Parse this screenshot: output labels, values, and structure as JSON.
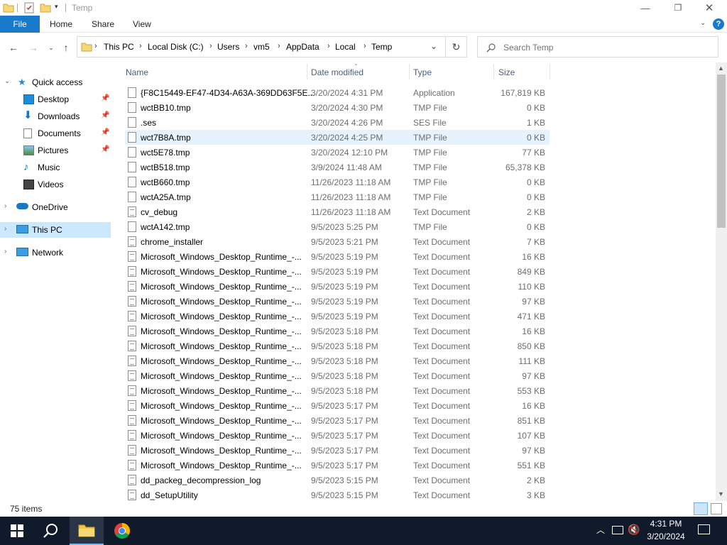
{
  "window": {
    "title": "Temp",
    "min_icon": "minimize-icon",
    "max_icon": "maximize-icon",
    "close_icon": "close-icon"
  },
  "ribbon": {
    "tabs": [
      {
        "label": "File"
      },
      {
        "label": "Home"
      },
      {
        "label": "Share"
      },
      {
        "label": "View"
      }
    ]
  },
  "address": {
    "crumbs": [
      "This PC",
      "Local Disk (C:)",
      "Users",
      "vm5",
      "AppData",
      "Local",
      "Temp"
    ]
  },
  "search": {
    "placeholder": "Search Temp"
  },
  "nav": {
    "quick_access": "Quick access",
    "items": [
      {
        "label": "Desktop",
        "icon": "desktop-icon",
        "pinned": true
      },
      {
        "label": "Downloads",
        "icon": "downloads-icon",
        "pinned": true
      },
      {
        "label": "Documents",
        "icon": "documents-icon",
        "pinned": true
      },
      {
        "label": "Pictures",
        "icon": "pictures-icon",
        "pinned": true
      },
      {
        "label": "Music",
        "icon": "music-icon",
        "pinned": false
      },
      {
        "label": "Videos",
        "icon": "videos-icon",
        "pinned": false
      }
    ],
    "onedrive": "OneDrive",
    "this_pc": "This PC",
    "network": "Network"
  },
  "columns": {
    "name": "Name",
    "date": "Date modified",
    "type": "Type",
    "size": "Size"
  },
  "files": [
    {
      "name": "{F8C15449-EF47-4D34-A63A-369DD63F5E...",
      "date": "3/20/2024 4:31 PM",
      "type": "Application",
      "size": "167,819 KB"
    },
    {
      "name": "wctBB10.tmp",
      "date": "3/20/2024 4:30 PM",
      "type": "TMP File",
      "size": "0 KB"
    },
    {
      "name": ".ses",
      "date": "3/20/2024 4:26 PM",
      "type": "SES File",
      "size": "1 KB"
    },
    {
      "name": "wct7B8A.tmp",
      "date": "3/20/2024 4:25 PM",
      "type": "TMP File",
      "size": "0 KB"
    },
    {
      "name": "wct5E78.tmp",
      "date": "3/20/2024 12:10 PM",
      "type": "TMP File",
      "size": "77 KB"
    },
    {
      "name": "wctB518.tmp",
      "date": "3/9/2024 11:48 AM",
      "type": "TMP File",
      "size": "65,378 KB"
    },
    {
      "name": "wctB660.tmp",
      "date": "11/26/2023 11:18 AM",
      "type": "TMP File",
      "size": "0 KB"
    },
    {
      "name": "wctA25A.tmp",
      "date": "11/26/2023 11:18 AM",
      "type": "TMP File",
      "size": "0 KB"
    },
    {
      "name": "cv_debug",
      "date": "11/26/2023 11:18 AM",
      "type": "Text Document",
      "size": "2 KB"
    },
    {
      "name": "wctA142.tmp",
      "date": "9/5/2023 5:25 PM",
      "type": "TMP File",
      "size": "0 KB"
    },
    {
      "name": "chrome_installer",
      "date": "9/5/2023 5:21 PM",
      "type": "Text Document",
      "size": "7 KB"
    },
    {
      "name": "Microsoft_Windows_Desktop_Runtime_-...",
      "date": "9/5/2023 5:19 PM",
      "type": "Text Document",
      "size": "16 KB"
    },
    {
      "name": "Microsoft_Windows_Desktop_Runtime_-...",
      "date": "9/5/2023 5:19 PM",
      "type": "Text Document",
      "size": "849 KB"
    },
    {
      "name": "Microsoft_Windows_Desktop_Runtime_-...",
      "date": "9/5/2023 5:19 PM",
      "type": "Text Document",
      "size": "110 KB"
    },
    {
      "name": "Microsoft_Windows_Desktop_Runtime_-...",
      "date": "9/5/2023 5:19 PM",
      "type": "Text Document",
      "size": "97 KB"
    },
    {
      "name": "Microsoft_Windows_Desktop_Runtime_-...",
      "date": "9/5/2023 5:19 PM",
      "type": "Text Document",
      "size": "471 KB"
    },
    {
      "name": "Microsoft_Windows_Desktop_Runtime_-...",
      "date": "9/5/2023 5:18 PM",
      "type": "Text Document",
      "size": "16 KB"
    },
    {
      "name": "Microsoft_Windows_Desktop_Runtime_-...",
      "date": "9/5/2023 5:18 PM",
      "type": "Text Document",
      "size": "850 KB"
    },
    {
      "name": "Microsoft_Windows_Desktop_Runtime_-...",
      "date": "9/5/2023 5:18 PM",
      "type": "Text Document",
      "size": "111 KB"
    },
    {
      "name": "Microsoft_Windows_Desktop_Runtime_-...",
      "date": "9/5/2023 5:18 PM",
      "type": "Text Document",
      "size": "97 KB"
    },
    {
      "name": "Microsoft_Windows_Desktop_Runtime_-...",
      "date": "9/5/2023 5:18 PM",
      "type": "Text Document",
      "size": "553 KB"
    },
    {
      "name": "Microsoft_Windows_Desktop_Runtime_-...",
      "date": "9/5/2023 5:17 PM",
      "type": "Text Document",
      "size": "16 KB"
    },
    {
      "name": "Microsoft_Windows_Desktop_Runtime_-...",
      "date": "9/5/2023 5:17 PM",
      "type": "Text Document",
      "size": "851 KB"
    },
    {
      "name": "Microsoft_Windows_Desktop_Runtime_-...",
      "date": "9/5/2023 5:17 PM",
      "type": "Text Document",
      "size": "107 KB"
    },
    {
      "name": "Microsoft_Windows_Desktop_Runtime_-...",
      "date": "9/5/2023 5:17 PM",
      "type": "Text Document",
      "size": "97 KB"
    },
    {
      "name": "Microsoft_Windows_Desktop_Runtime_-...",
      "date": "9/5/2023 5:17 PM",
      "type": "Text Document",
      "size": "551 KB"
    },
    {
      "name": "dd_packeg_decompression_log",
      "date": "9/5/2023 5:15 PM",
      "type": "Text Document",
      "size": "2 KB"
    },
    {
      "name": "dd_SetupUtility",
      "date": "9/5/2023 5:15 PM",
      "type": "Text Document",
      "size": "3 KB"
    }
  ],
  "status": {
    "item_count": "75 items"
  },
  "taskbar": {
    "time": "4:31 PM",
    "date": "3/20/2024"
  },
  "colors": {
    "file_tab": "#1979ca",
    "taskbar": "#101a2a",
    "selected_nav": "#cce8ff",
    "folder": "#f8d775"
  }
}
